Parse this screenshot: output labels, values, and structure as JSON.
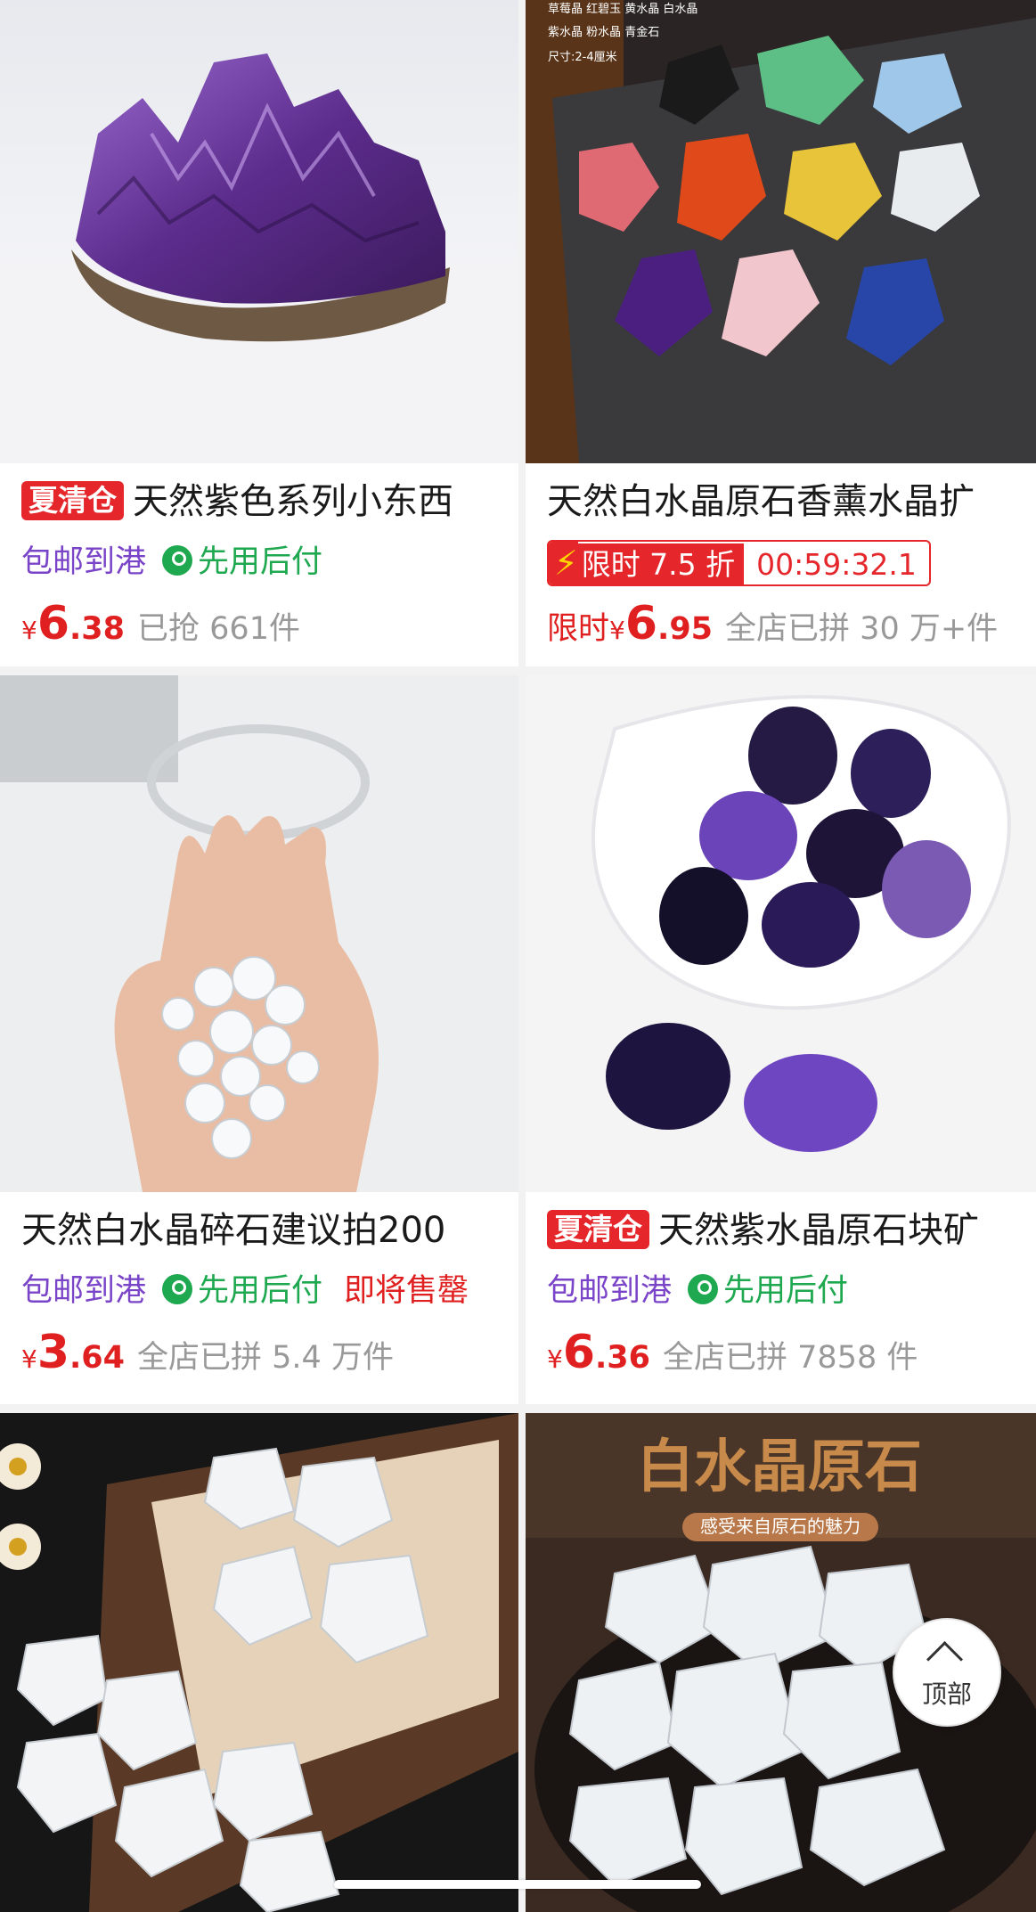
{
  "products": [
    {
      "title": "天然紫色系列小东西",
      "badge": "夏清仓",
      "tags": {
        "shipping": "包邮到港",
        "pay": "先用后付"
      },
      "price": {
        "currency": "¥",
        "int": "6",
        "dec": ".38"
      },
      "sold": "已抢 661件",
      "image": "amethyst-cluster"
    },
    {
      "title": "天然白水晶原石香薰水晶扩",
      "flash": {
        "label": "限时 7.5 折",
        "countdown": "00:59:32.1"
      },
      "price": {
        "prefix": "限时",
        "currency": "¥",
        "int": "6",
        "dec": ".95"
      },
      "sold": "全店已拼 30 万+件",
      "image": "mixed-rough-stones",
      "image_text": {
        "line1": "草莓晶 红碧玉 黄水晶 白水晶",
        "line2": "紫水晶 粉水晶 青金石",
        "line3": "尺寸:2-4厘米"
      }
    },
    {
      "title": "天然白水晶碎石建议拍200",
      "tags": {
        "shipping": "包邮到港",
        "pay": "先用后付",
        "extra": "即将售罄"
      },
      "price": {
        "currency": "¥",
        "int": "3",
        "dec": ".64"
      },
      "sold": "全店已拼 5.4 万件",
      "image": "clear-quartz-chips-in-hand"
    },
    {
      "title": "天然紫水晶原石块矿",
      "badge": "夏清仓",
      "tags": {
        "shipping": "包邮到港",
        "pay": "先用后付"
      },
      "price": {
        "currency": "¥",
        "int": "6",
        "dec": ".36"
      },
      "sold": "全店已拼 7858 件",
      "image": "amethyst-tumbled-stones"
    },
    {
      "image": "clear-quartz-rough-in-box"
    },
    {
      "image": "clear-quartz-rough-pile",
      "image_text": {
        "title": "白水晶原石",
        "subtitle": "感受来自原石的魅力"
      }
    }
  ],
  "back_to_top": {
    "label": "顶部"
  },
  "colors": {
    "red": "#e02020",
    "purple": "#7a44c9",
    "green": "#1ea84f",
    "gray": "#999999"
  }
}
